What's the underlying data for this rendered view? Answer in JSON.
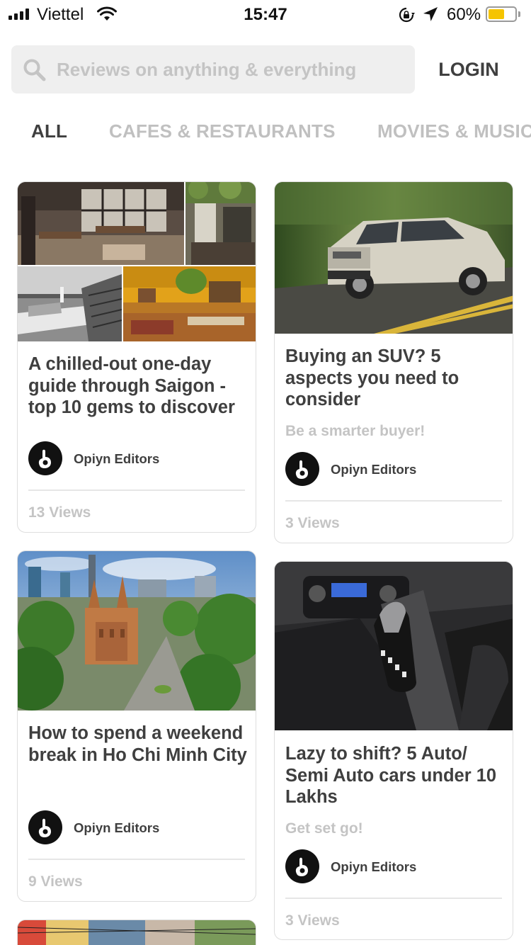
{
  "status_bar": {
    "carrier": "Viettel",
    "time": "15:47",
    "battery_percent": "60%",
    "battery_level": 0.6,
    "battery_color": "#f5c400",
    "icons": [
      "signal-icon",
      "wifi-icon",
      "rotation-lock-icon",
      "location-arrow-icon",
      "battery-icon"
    ]
  },
  "search": {
    "placeholder": "Reviews on anything & everything",
    "value": "",
    "icon": "search-icon"
  },
  "header": {
    "login_label": "LOGIN"
  },
  "tabs": [
    {
      "label": "ALL",
      "active": true
    },
    {
      "label": "CAFES & RESTAURANTS",
      "active": false
    },
    {
      "label": "MOVIES & MUSIC",
      "active": false
    }
  ],
  "cards": [
    {
      "title": "A chilled-out one-day guide through Saigon - top 10 gems to discover",
      "subtitle": "",
      "author": "Opiyn Editors",
      "views": "13 Views",
      "image": "cafe-collage"
    },
    {
      "title": "Buying an SUV? 5 aspects you need to consider",
      "subtitle": "Be a smarter buyer!",
      "author": "Opiyn Editors",
      "views": "3 Views",
      "image": "suv-on-road"
    },
    {
      "title": "How to spend a weekend break in Ho Chi Minh City",
      "subtitle": "",
      "author": "Opiyn Editors",
      "views": "9 Views",
      "image": "city-aerial-cathedral"
    },
    {
      "title": "Lazy to shift? 5 Auto/ Semi Auto cars under 10 Lakhs",
      "subtitle": "Get set go!",
      "author": "Opiyn Editors",
      "views": "3 Views",
      "image": "car-gear-shifter"
    },
    {
      "title": "",
      "subtitle": "",
      "author": "",
      "views": "",
      "image": "street-scene"
    }
  ],
  "colors": {
    "text_primary": "#3f3f3f",
    "text_muted": "#c4c4c4",
    "search_bg": "#efefef",
    "card_border": "#dedede"
  }
}
